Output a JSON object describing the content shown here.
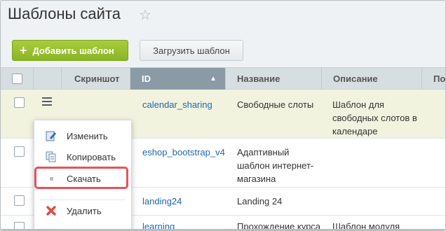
{
  "page": {
    "title": "Шаблоны сайта",
    "favorite_icon": "star-icon"
  },
  "toolbar": {
    "add_label": "Добавить шаблон",
    "upload_label": "Загрузить шаблон",
    "add_color": "#9bc232"
  },
  "grid": {
    "columns": [
      "Скриншот",
      "ID",
      "Название",
      "Описание",
      "По"
    ],
    "sorted_column": "ID",
    "sort_direction": "ascending",
    "rows": [
      {
        "id": "calendar_sharing",
        "name": "Свободные слоты",
        "description": "Шаблон для свободных слотов в календаре",
        "selected": true
      },
      {
        "id": "eshop_bootstrap_v4",
        "name": "Адаптивный шаблон интернет-магазина",
        "description": ""
      },
      {
        "id": "landing24",
        "name": "Landing 24",
        "description": ""
      },
      {
        "id": "learning",
        "name": "Прохождение курса",
        "description": "Шаблон модуля"
      }
    ]
  },
  "context_menu": {
    "items": [
      {
        "label": "Изменить",
        "icon": "edit-icon"
      },
      {
        "label": "Копировать",
        "icon": "copy-icon"
      },
      {
        "label": "Скачать",
        "icon": "download-icon",
        "highlighted": true
      },
      {
        "label": "Удалить",
        "icon": "delete-icon"
      }
    ],
    "highlight_color": "#e8525a"
  }
}
